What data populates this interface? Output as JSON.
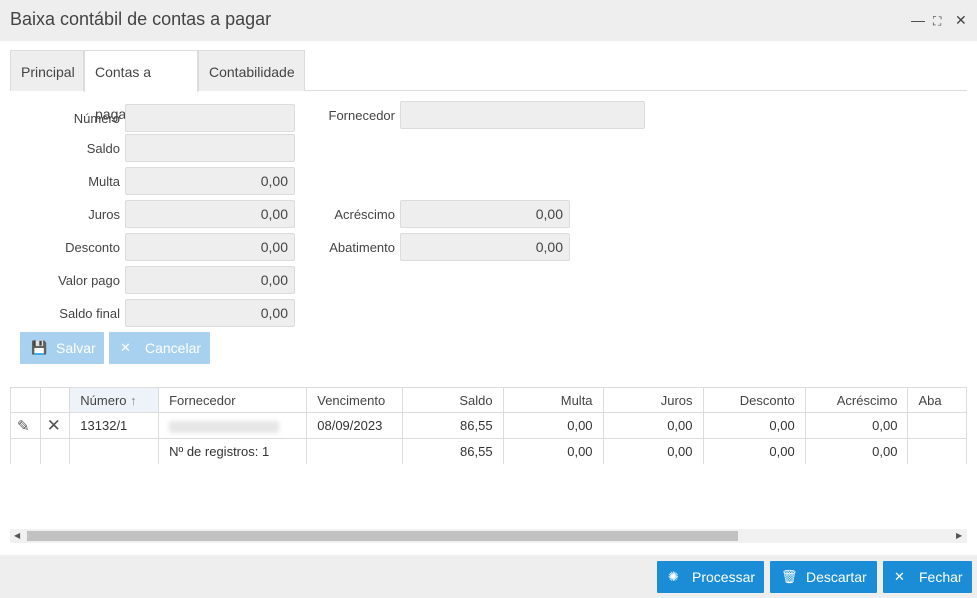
{
  "window": {
    "title": "Baixa contábil de contas a pagar"
  },
  "tabs": [
    {
      "label": "Principal"
    },
    {
      "label": "Contas a pagar"
    },
    {
      "label": "Contabilidade"
    }
  ],
  "form": {
    "numero_label": "Número",
    "numero_value": "",
    "fornecedor_label": "Fornecedor",
    "fornecedor_value": "",
    "saldo_label": "Saldo",
    "saldo_value": "",
    "multa_label": "Multa",
    "multa_value": "0,00",
    "juros_label": "Juros",
    "juros_value": "0,00",
    "acrescimo_label": "Acréscimo",
    "acrescimo_value": "0,00",
    "desconto_label": "Desconto",
    "desconto_value": "0,00",
    "abatimento_label": "Abatimento",
    "abatimento_value": "0,00",
    "valor_pago_label": "Valor pago",
    "valor_pago_value": "0,00",
    "saldo_final_label": "Saldo final",
    "saldo_final_value": "0,00"
  },
  "form_buttons": {
    "salvar": "Salvar",
    "cancelar": "Cancelar"
  },
  "grid": {
    "columns": [
      "Número",
      "Fornecedor",
      "Vencimento",
      "Saldo",
      "Multa",
      "Juros",
      "Desconto",
      "Acréscimo",
      "Aba"
    ],
    "sort_indicator": "↑",
    "rows": [
      {
        "numero": "13132/1",
        "fornecedor": "",
        "vencimento": "08/09/2023",
        "saldo": "86,55",
        "multa": "0,00",
        "juros": "0,00",
        "desconto": "0,00",
        "acrescimo": "0,00"
      }
    ],
    "footer": {
      "registros": "Nº de registros: 1",
      "saldo": "86,55",
      "multa": "0,00",
      "juros": "0,00",
      "desconto": "0,00",
      "acrescimo": "0,00"
    }
  },
  "footer_buttons": {
    "processar": "Processar",
    "descartar": "Descartar",
    "fechar": "Fechar"
  }
}
